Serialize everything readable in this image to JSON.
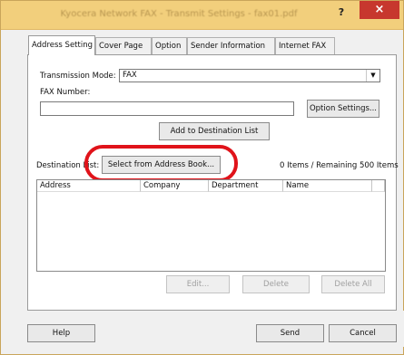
{
  "window": {
    "title": "Kyocera Network FAX - Transmit Settings - fax01.pdf",
    "help_label": "?",
    "close_label": "×"
  },
  "tabs": [
    {
      "label": "Address Setting",
      "active": true
    },
    {
      "label": "Cover Page",
      "active": false
    },
    {
      "label": "Option",
      "active": false
    },
    {
      "label": "Sender Information",
      "active": false
    },
    {
      "label": "Internet FAX",
      "active": false
    }
  ],
  "address_setting": {
    "transmission_mode_label": "Transmission Mode:",
    "transmission_mode_value": "FAX",
    "fax_number_label": "FAX Number:",
    "fax_number_value": "",
    "option_settings_label": "Option Settings...",
    "add_to_destination_label": "Add to Destination List",
    "destination_list_label": "Destination List:",
    "select_address_book_label": "Select from Address Book...",
    "items_status": "0 Items / Remaining 500 Items",
    "columns": [
      "Address",
      "Company",
      "Department",
      "Name"
    ],
    "rows": [],
    "edit_label": "Edit...",
    "delete_label": "Delete",
    "delete_all_label": "Delete All"
  },
  "footer": {
    "help_label": "Help",
    "send_label": "Send",
    "cancel_label": "Cancel"
  },
  "colors": {
    "titlebar": "#f2cf7c",
    "close_button": "#c7372e",
    "highlight_ring": "#e0131a"
  }
}
